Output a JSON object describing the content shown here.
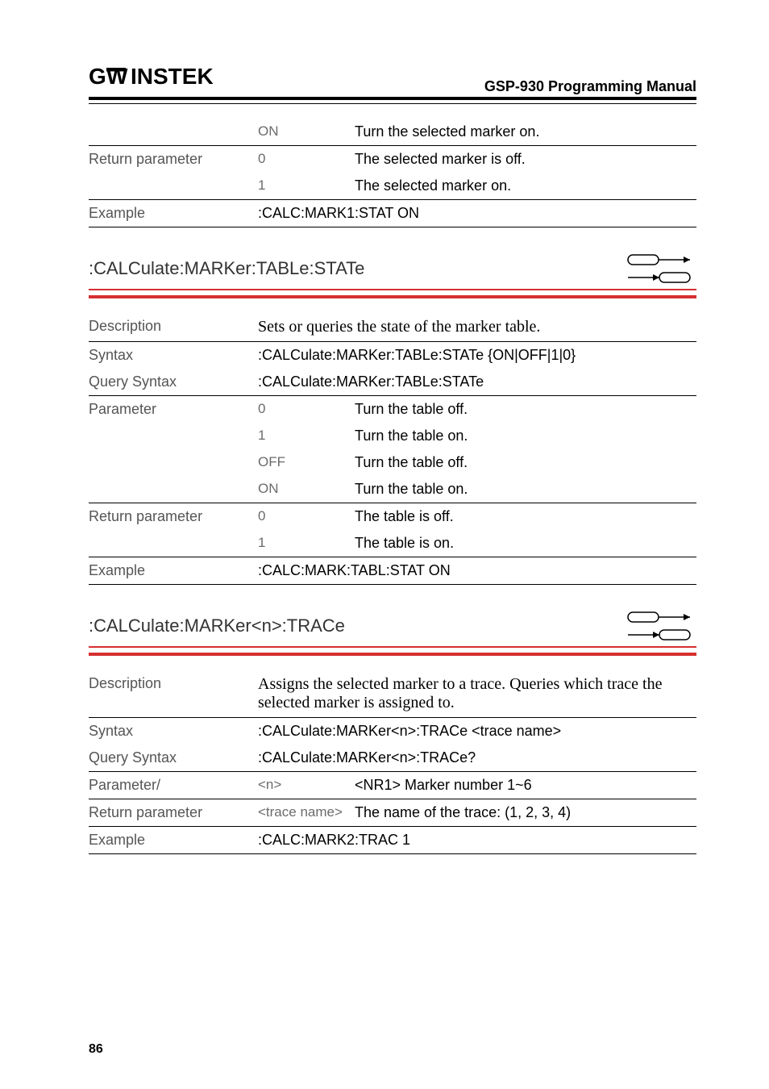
{
  "header": {
    "logo": "GWINSTEK",
    "doc_title": "GSP-930 Programming Manual"
  },
  "top_block": {
    "rows": [
      {
        "label": "",
        "key": "ON",
        "val": "Turn the selected marker on."
      }
    ],
    "return_rows": [
      {
        "label": "Return parameter",
        "key": "0",
        "val": "The selected marker is off."
      },
      {
        "label": "",
        "key": "1",
        "val": "The selected marker on."
      }
    ],
    "example": {
      "label": "Example",
      "val": ":CALC:MARK1:STAT ON"
    }
  },
  "sec1": {
    "title": ":CALCulate:MARKer:TABLe:STATe",
    "desc": {
      "label": "Description",
      "val": "Sets or queries the state of the marker table."
    },
    "syntax": {
      "label": "Syntax",
      "val": ":CALCulate:MARKer:TABLe:STATe {ON|OFF|1|0}"
    },
    "query": {
      "label": "Query Syntax",
      "val": ":CALCulate:MARKer:TABLe:STATe"
    },
    "params": [
      {
        "label": "Parameter",
        "key": "0",
        "val": "Turn the table off."
      },
      {
        "label": "",
        "key": "1",
        "val": "Turn the table on."
      },
      {
        "label": "",
        "key": "OFF",
        "val": "Turn the table off."
      },
      {
        "label": "",
        "key": "ON",
        "val": "Turn the table on."
      }
    ],
    "returns": [
      {
        "label": "Return parameter",
        "key": "0",
        "val": "The table is off."
      },
      {
        "label": "",
        "key": "1",
        "val": "The table is on."
      }
    ],
    "example": {
      "label": "Example",
      "val": ":CALC:MARK:TABL:STAT ON"
    }
  },
  "sec2": {
    "title": ":CALCulate:MARKer<n>:TRACe",
    "desc": {
      "label": "Description",
      "val": "Assigns the selected marker to a trace. Queries which trace the selected marker is assigned to."
    },
    "syntax": {
      "label": "Syntax",
      "val": ":CALCulate:MARKer<n>:TRACe <trace name>"
    },
    "query": {
      "label": "Query Syntax",
      "val": ":CALCulate:MARKer<n>:TRACe?"
    },
    "params": [
      {
        "label": "Parameter/",
        "key": "<n>",
        "val": "<NR1> Marker number 1~6"
      },
      {
        "label": "Return parameter",
        "key": "<trace name>",
        "val": "The name of the trace: (1, 2, 3, 4)"
      }
    ],
    "example": {
      "label": "Example",
      "val": ":CALC:MARK2:TRAC 1"
    }
  },
  "page_num": "86"
}
